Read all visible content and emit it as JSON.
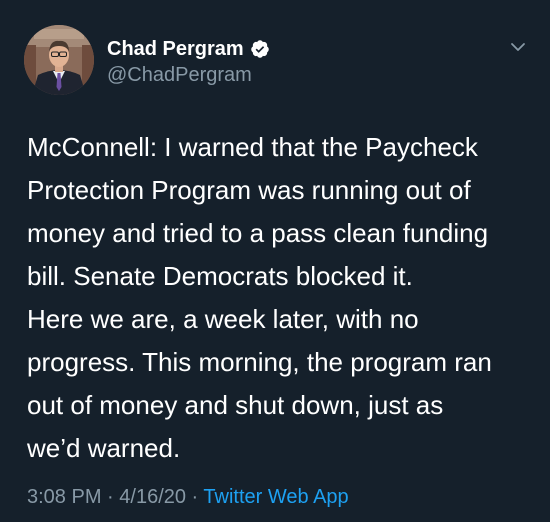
{
  "author": {
    "display_name": "Chad Pergram",
    "handle": "@ChadPergram",
    "verified": true,
    "verified_icon": "verified-badge-icon"
  },
  "menu_icon": "chevron-down-icon",
  "tweet": {
    "lines": [
      "McConnell: I warned that the Paycheck",
      "Protection Program was running out of",
      "money and tried to a pass clean funding",
      "bill. Senate Democrats blocked it.",
      "Here we are, a week later, with no",
      "progress. This morning, the program ran",
      "out of money and shut down, just as",
      "we’d warned."
    ]
  },
  "meta": {
    "time": "3:08 PM",
    "separator1": " · ",
    "date": "4/16/20",
    "separator2": " · ",
    "source": "Twitter Web App"
  },
  "colors": {
    "background": "#15202b",
    "text": "#ffffff",
    "secondary_text": "#8899a6",
    "link": "#1da1f2"
  }
}
